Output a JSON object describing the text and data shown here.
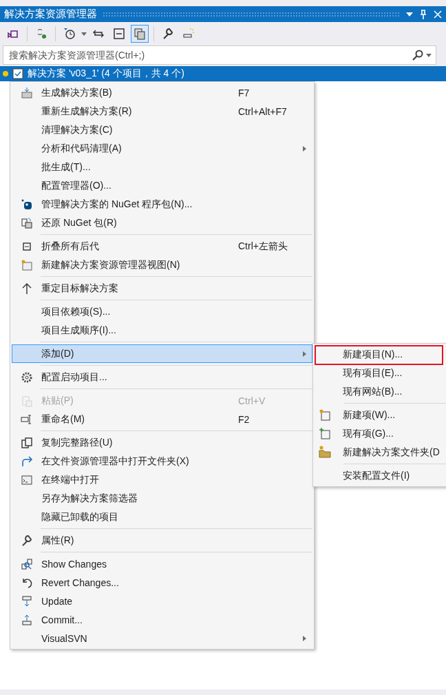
{
  "window": {
    "title": "解决方案资源管理器"
  },
  "toolbar": {
    "buttons": [
      {
        "pressed": false
      },
      {
        "pressed": false
      },
      {
        "pressed": false
      },
      {
        "pressed": false
      },
      {
        "pressed": false
      },
      {
        "pressed": true
      },
      {
        "pressed": false
      },
      {
        "pressed": false
      }
    ]
  },
  "search": {
    "placeholder": "搜索解决方案资源管理器(Ctrl+;)"
  },
  "tree": {
    "items": [
      {
        "label": "解决方案 'v03_1' (4 个项目，共 4 个)",
        "selected": true
      }
    ]
  },
  "context_menu": {
    "groups": [
      [
        {
          "label": "生成解决方案(B)",
          "shortcut": "F7",
          "submenu": false,
          "disabled": false,
          "selected": false
        },
        {
          "label": "重新生成解决方案(R)",
          "shortcut": "Ctrl+Alt+F7",
          "submenu": false,
          "disabled": false,
          "selected": false
        },
        {
          "label": "清理解决方案(C)",
          "submenu": false,
          "disabled": false,
          "selected": false
        },
        {
          "label": "分析和代码清理(A)",
          "submenu": true,
          "disabled": false,
          "selected": false
        },
        {
          "label": "批生成(T)...",
          "submenu": false,
          "disabled": false,
          "selected": false
        },
        {
          "label": "配置管理器(O)...",
          "submenu": false,
          "disabled": false,
          "selected": false
        },
        {
          "label": "管理解决方案的 NuGet 程序包(N)...",
          "submenu": false,
          "disabled": false,
          "selected": false
        },
        {
          "label": "还原 NuGet 包(R)",
          "submenu": false,
          "disabled": false,
          "selected": false
        }
      ],
      [
        {
          "label": "折叠所有后代",
          "shortcut": "Ctrl+左箭头",
          "submenu": false,
          "disabled": false,
          "selected": false
        },
        {
          "label": "新建解决方案资源管理器视图(N)",
          "submenu": false,
          "disabled": false,
          "selected": false
        }
      ],
      [
        {
          "label": "重定目标解决方案",
          "submenu": false,
          "disabled": false,
          "selected": false
        }
      ],
      [
        {
          "label": "项目依赖项(S)...",
          "submenu": false,
          "disabled": false,
          "selected": false
        },
        {
          "label": "项目生成顺序(I)...",
          "submenu": false,
          "disabled": false,
          "selected": false
        }
      ],
      [
        {
          "label": "添加(D)",
          "submenu": true,
          "disabled": false,
          "selected": true
        }
      ],
      [
        {
          "label": "配置启动项目...",
          "submenu": false,
          "disabled": false,
          "selected": false
        }
      ],
      [
        {
          "label": "粘贴(P)",
          "shortcut": "Ctrl+V",
          "submenu": false,
          "disabled": true,
          "selected": false
        },
        {
          "label": "重命名(M)",
          "shortcut": "F2",
          "submenu": false,
          "disabled": false,
          "selected": false
        }
      ],
      [
        {
          "label": "复制完整路径(U)",
          "submenu": false,
          "disabled": false,
          "selected": false
        },
        {
          "label": "在文件资源管理器中打开文件夹(X)",
          "submenu": false,
          "disabled": false,
          "selected": false
        },
        {
          "label": "在终端中打开",
          "submenu": false,
          "disabled": false,
          "selected": false
        },
        {
          "label": "另存为解决方案筛选器",
          "submenu": false,
          "disabled": false,
          "selected": false
        },
        {
          "label": "隐藏已卸载的项目",
          "submenu": false,
          "disabled": false,
          "selected": false
        }
      ],
      [
        {
          "label": "属性(R)",
          "submenu": false,
          "disabled": false,
          "selected": false
        }
      ],
      [
        {
          "label": "Show Changes",
          "submenu": false,
          "disabled": false,
          "selected": false
        },
        {
          "label": "Revert Changes...",
          "submenu": false,
          "disabled": false,
          "selected": false
        },
        {
          "label": "Update",
          "submenu": false,
          "disabled": false,
          "selected": false
        },
        {
          "label": "Commit...",
          "submenu": false,
          "disabled": false,
          "selected": false
        },
        {
          "label": "VisualSVN",
          "submenu": true,
          "disabled": false,
          "selected": false
        }
      ]
    ]
  },
  "add_submenu": {
    "groups": [
      [
        {
          "label": "新建项目(N)...",
          "highlighted": true
        },
        {
          "label": "现有项目(E)...",
          "highlighted": false
        },
        {
          "label": "现有网站(B)...",
          "highlighted": false
        }
      ],
      [
        {
          "label": "新建项(W)...",
          "highlighted": false
        },
        {
          "label": "现有项(G)...",
          "highlighted": false
        },
        {
          "label": "新建解决方案文件夹(D",
          "highlighted": false
        }
      ],
      [
        {
          "label": "安装配置文件(I)",
          "highlighted": false
        }
      ]
    ]
  }
}
